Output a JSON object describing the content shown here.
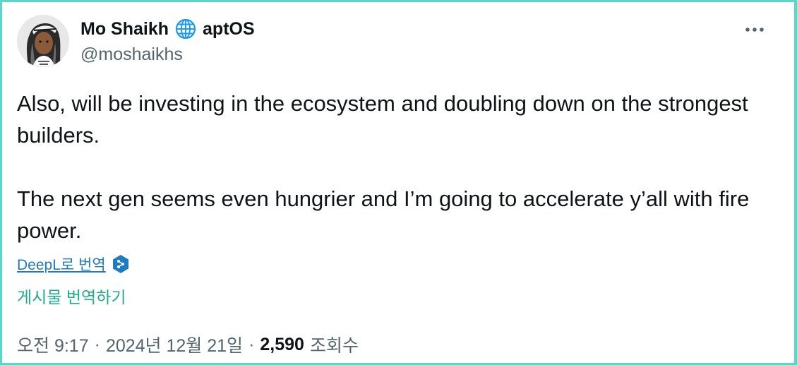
{
  "author": {
    "display_name": "Mo Shaikh",
    "affiliation_icon": "globe-icon",
    "affiliation": "aptOS",
    "handle": "@moshaikhs"
  },
  "menu": {
    "more_icon": "more-horizontal-icon"
  },
  "post": {
    "paragraphs": [
      "Also, will be investing in the ecosystem and doubling down on the strongest builders.",
      "The next gen seems even hungrier and I’m going to accelerate y’all with fire power."
    ]
  },
  "translation": {
    "deepl_label": "DeepL로 번역",
    "deepl_icon": "deepl-icon",
    "translate_post_label": "게시물 번역하기"
  },
  "meta": {
    "time": "오전 9:17",
    "separator": "·",
    "date": "2024년 12월 21일",
    "views_count": "2,590",
    "views_label": "조회수"
  },
  "colors": {
    "border": "#5cd6c7",
    "text_primary": "#0f1419",
    "text_secondary": "#536471",
    "deepl_link": "#1d7bc4",
    "translate_link": "#1dae8a",
    "globe_icon": "#1d9bf0"
  }
}
